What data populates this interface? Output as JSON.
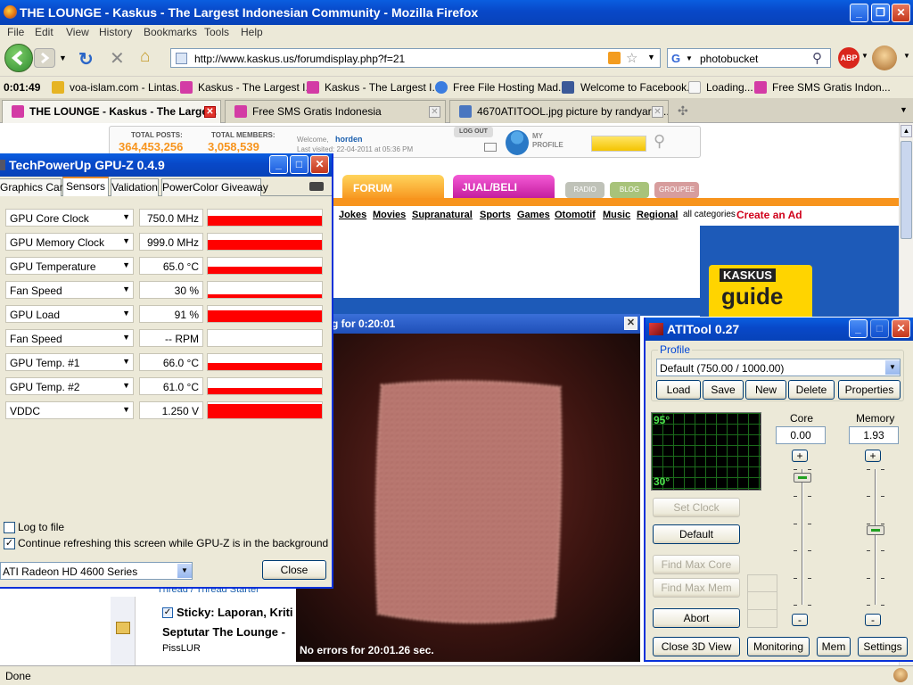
{
  "firefox": {
    "title": "THE LOUNGE - Kaskus - The Largest Indonesian Community - Mozilla Firefox",
    "menu": [
      "File",
      "Edit",
      "View",
      "History",
      "Bookmarks",
      "Tools",
      "Help"
    ],
    "url": "http://www.kaskus.us/forumdisplay.php?f=21",
    "search": "photobucket",
    "clock": "0:01:49",
    "bookmarks": [
      "voa-islam.com - Lintas...",
      "Kaskus - The Largest I...",
      "Kaskus - The Largest I...",
      "Free File Hosting Mad...",
      "Welcome to Facebook...",
      "Loading...",
      "Free SMS Gratis Indon..."
    ],
    "tabs": [
      "THE LOUNGE - Kaskus - The Large...",
      "Free SMS Gratis Indonesia",
      "4670ATITOOL.jpg picture by randyarm..."
    ],
    "status": "Done"
  },
  "kaskus": {
    "total_posts_label": "TOTAL POSTS:",
    "total_posts": "364,453,256",
    "total_members_label": "TOTAL MEMBERS:",
    "total_members": "3,058,539",
    "logout": "LOG OUT",
    "welcome": "Welcome,",
    "user": "horden",
    "last_visited": "Last visited: 22-04-2011 at 05:36 PM",
    "my_profile": "MY\nPROFILE",
    "nav_forum": "FORUM",
    "nav_jualbeli": "JUAL/BELI",
    "nav_radio": "RADIO",
    "nav_blog": "BLOG",
    "nav_groupee": "GROUPEE",
    "categories": [
      "Jokes",
      "Movies",
      "Supranatural",
      "Sports",
      "Games",
      "Otomotif",
      "Music",
      "Regional"
    ],
    "all_categories": "all categories",
    "create_ad": "Create an Ad",
    "ad_logo": "KASKUS",
    "ad_text": "guide",
    "thread_header": "Thread / Thread Starter",
    "sticky_label": "Sticky:",
    "sticky_title": "Laporan, Kriti",
    "thread_title": "Septutar The Lounge -",
    "thread_author": "PissLUR"
  },
  "gpuz": {
    "title": "TechPowerUp GPU-Z 0.4.9",
    "tabs": [
      "Graphics Card",
      "Sensors",
      "Validation",
      "PowerColor Giveaway"
    ],
    "sensors": [
      {
        "name": "GPU Core Clock",
        "value": "750.0 MHz",
        "level": 0.62
      },
      {
        "name": "GPU Memory Clock",
        "value": "999.0 MHz",
        "level": 0.62
      },
      {
        "name": "GPU Temperature",
        "value": "65.0 °C",
        "level": 0.45
      },
      {
        "name": "Fan Speed",
        "value": "30 %",
        "level": 0.22
      },
      {
        "name": "GPU Load",
        "value": "91 %",
        "level": 0.75
      },
      {
        "name": "Fan Speed",
        "value": "-- RPM",
        "level": 0
      },
      {
        "name": "GPU Temp. #1",
        "value": "66.0 °C",
        "level": 0.45
      },
      {
        "name": "GPU Temp. #2",
        "value": "61.0 °C",
        "level": 0.4
      },
      {
        "name": "VDDC",
        "value": "1.250 V",
        "level": 0.9
      }
    ],
    "log_to_file": "Log to file",
    "continue_refresh": "Continue refreshing this screen while GPU-Z is in the background",
    "card": "ATI Radeon HD 4600 Series",
    "close": "Close"
  },
  "render3d": {
    "title": "g for 0:20:01",
    "status": "No errors for 20:01.26 sec."
  },
  "atitool": {
    "title": "ATITool 0.27",
    "profile_label": "Profile",
    "profile_value": "Default (750.00 / 1000.00)",
    "buttons": [
      "Load",
      "Save",
      "New",
      "Delete",
      "Properties"
    ],
    "temp_max": "95°",
    "temp_min": "30°",
    "core_label": "Core",
    "core_value": "0.00",
    "memory_label": "Memory",
    "memory_value": "1.93",
    "plus": "+",
    "minus": "-",
    "set_clock": "Set Clock",
    "default": "Default",
    "find_max_core": "Find Max Core",
    "find_max_mem": "Find Max Mem",
    "abort": "Abort",
    "close_3d": "Close 3D View",
    "monitoring": "Monitoring",
    "mem": "Mem",
    "settings": "Settings",
    "core_slider_level": 0.97,
    "memory_slider_level": 0.55
  },
  "colors": {
    "xp_blue": "#0a5ee0",
    "sensor_red": "#ff0000",
    "kaskus_orange": "#f7941d",
    "kaskus_magenta": "#c0199a"
  }
}
